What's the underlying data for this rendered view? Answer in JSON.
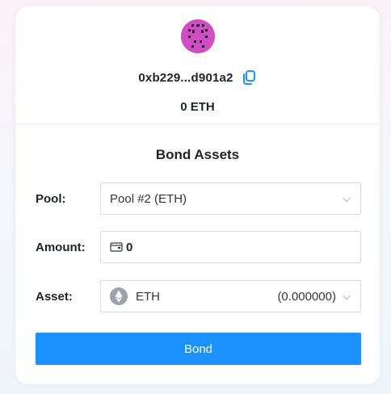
{
  "account": {
    "address": "0xb229...d901a2",
    "balance": "0 ETH"
  },
  "form": {
    "title": "Bond Assets",
    "pool": {
      "label": "Pool:",
      "selected": "Pool #2 (ETH)"
    },
    "amount": {
      "label": "Amount:",
      "value": "0"
    },
    "asset": {
      "label": "Asset:",
      "name": "ETH",
      "balance": "(0.000000)"
    },
    "submit_label": "Bond"
  },
  "colors": {
    "accent": "#1c92ff",
    "avatar": "#d24cc3",
    "avatar_pattern": "#2a1030"
  },
  "icons": {
    "copy": "copy-icon",
    "wallet": "wallet-icon",
    "eth": "ethereum-icon",
    "dropdown": "chevron-down-icon"
  }
}
